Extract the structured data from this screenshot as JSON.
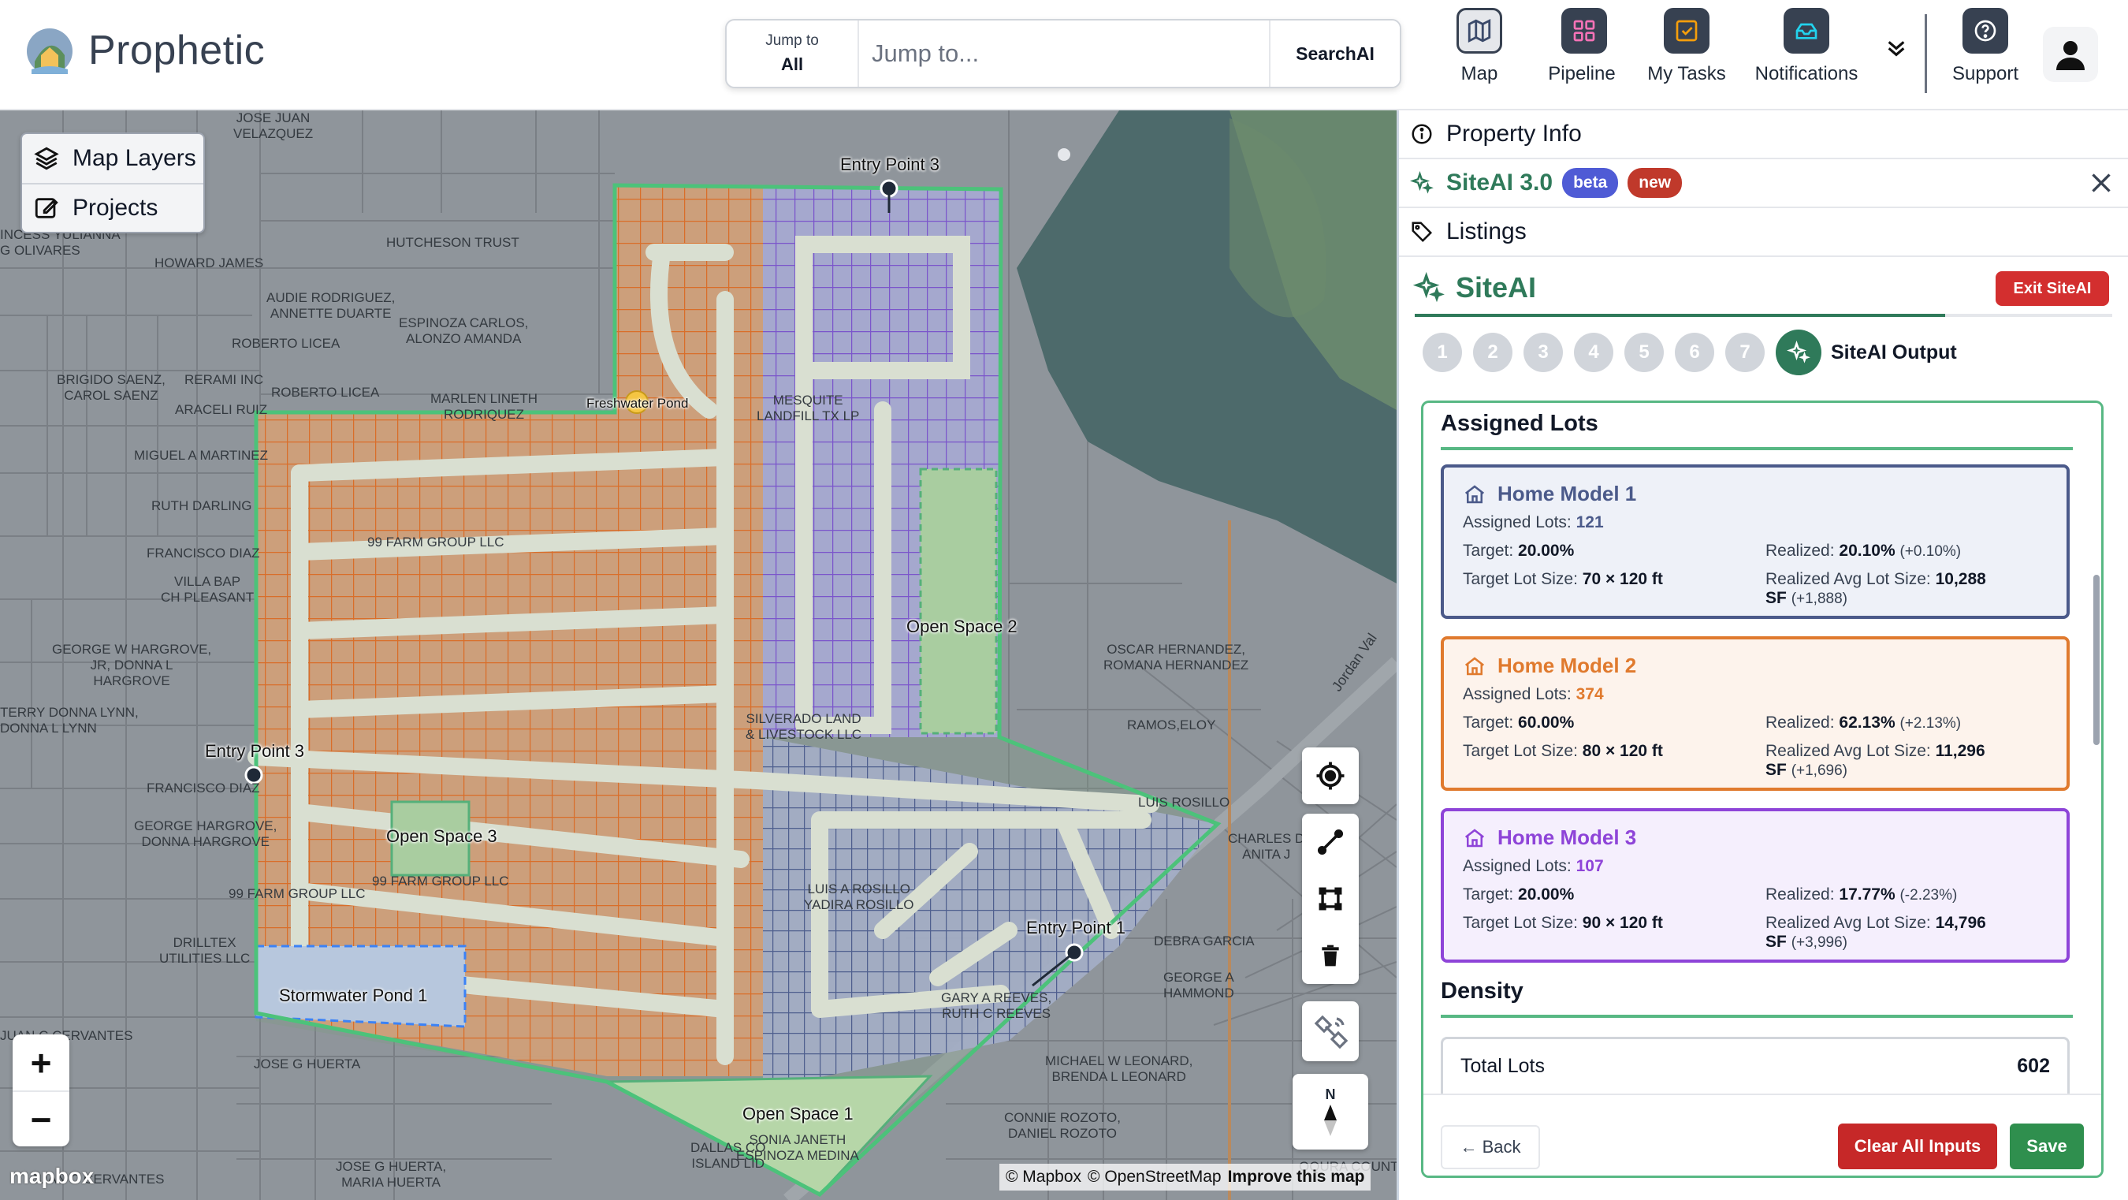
{
  "header": {
    "brand": "Prophetic",
    "search": {
      "scope_caption": "Jump to",
      "scope_value": "All",
      "placeholder": "Jump to...",
      "button": "SearchAI"
    },
    "nav": [
      {
        "label": "Map",
        "icon": "map-icon",
        "active": true
      },
      {
        "label": "Pipeline",
        "icon": "pipeline-icon"
      },
      {
        "label": "My Tasks",
        "icon": "tasks-icon"
      },
      {
        "label": "Notifications",
        "icon": "notifications-icon"
      },
      {
        "label": "Support",
        "icon": "support-icon"
      }
    ]
  },
  "map": {
    "layers_panel": {
      "map_layers": "Map Layers",
      "projects": "Projects"
    },
    "place_labels": {
      "entry1": "Entry Point 1",
      "entry3_top": "Entry Point 3",
      "entry3_left": "Entry Point 3",
      "open1": "Open Space 1",
      "open2": "Open Space 2",
      "open3": "Open Space 3",
      "storm": "Stormwater Pond 1",
      "fresh": "Freshwater Pond"
    },
    "owner_labels": [
      "JOSE JUAN\nVELAZQUEZ",
      "INCESS YULIANNA\nG OLIVARES",
      "HOWARD JAMES",
      "HUTCHESON TRUST",
      "AUDIE RODRIGUEZ,\nANNETTE DUARTE",
      "ESPINOZA CARLOS,\nALONZO AMANDA",
      "ROBERTO LICEA",
      "BRIGIDO SAENZ,\nCAROL SAENZ",
      "RERAMI INC",
      "ROBERTO LICEA",
      "ARACELI RUIZ",
      "MARLEN LINETH\nRODRIQUEZ",
      "MESQUITE\nLANDFILL TX LP",
      "MIGUEL A MARTINEZ",
      "RUTH DARLING",
      "99 FARM GROUP LLC",
      "FRANCISCO DIAZ",
      "VILLA BAP\nCH PLEASANT",
      "GEORGE W HARGROVE,\nJR, DONNA L\nHARGROVE",
      "TERRY DONNA LYNN,\nDONNA L LYNN",
      "SILVERADO LAND\n& LIVESTOCK LLC",
      "OSCAR HERNANDEZ,\nROMANA HERNANDEZ",
      "RAMOS,ELOY",
      "FRANCISCO DIAZ",
      "GEORGE HARGROVE,\nDONNA HARGROVE",
      "LUIS ROSILLO",
      "CHARLES D\nANITA J",
      "99 FARM GROUP LLC",
      "99 FARM GROUP LLC",
      "LUIS A ROSILLO\nYADIRA ROSILLO",
      "DRILLTEX\nUTILITIES LLC",
      "DEBRA GARCIA",
      "GEORGE A\nHAMMOND",
      "GARY A REEVES,\nRUTH C REEVES",
      "JOSE G HUERTA",
      "MICHAEL W LEONARD,\nBRENDA L LEONARD",
      "CONNIE ROZOTO,\nDANIEL ROZOTO",
      "SONIA JANETH\nESPINOZA MEDINA",
      "DALLAS CO\nISLAND LID",
      "JOSE G HUERTA,\nMARIA HUERTA",
      "JUAN C CERVANTES",
      "Jordan Val",
      "OQURA COUNT",
      "JUAN C CERVANTES"
    ],
    "compass_label": "N",
    "mapbox": "mapbox",
    "attribution": {
      "mapbox": "© Mapbox",
      "osm": "© OpenStreetMap",
      "improve": "Improve this map"
    },
    "zoom_in": "+",
    "zoom_out": "−"
  },
  "panel": {
    "property_info": "Property Info",
    "siteai_version": "SiteAI 3.0",
    "badge_beta": "beta",
    "badge_new": "new",
    "listings": "Listings",
    "siteai_title": "SiteAI",
    "exit_button": "Exit SiteAI",
    "steps": [
      "1",
      "2",
      "3",
      "4",
      "5",
      "6",
      "7"
    ],
    "step_output_label": "SiteAI Output",
    "progress": 0.76,
    "assigned_lots_title": "Assigned Lots",
    "labels": {
      "assigned_lots": "Assigned Lots:",
      "target": "Target:",
      "target_lot_size": "Target Lot Size:",
      "realized": "Realized:",
      "realized_avg_lot_size": "Realized Avg Lot Size:"
    },
    "models": [
      {
        "name": "Home Model 1",
        "assigned_lots": "121",
        "target": "20.00%",
        "target_lot_size": "70 × 120 ft",
        "realized": "20.10%",
        "realized_delta": "(+0.10%)",
        "realized_avg_lot_size": "10,288",
        "avg_unit": "SF",
        "avg_delta": "(+1,888)",
        "color": "#4b5a8a",
        "bg": "#eef1f8"
      },
      {
        "name": "Home Model 2",
        "assigned_lots": "374",
        "target": "60.00%",
        "target_lot_size": "80 × 120 ft",
        "realized": "62.13%",
        "realized_delta": "(+2.13%)",
        "realized_avg_lot_size": "11,296",
        "avg_unit": "SF",
        "avg_delta": "(+1,696)",
        "color": "#e07a2e",
        "bg": "#fdf3ec"
      },
      {
        "name": "Home Model 3",
        "assigned_lots": "107",
        "target": "20.00%",
        "target_lot_size": "90 × 120 ft",
        "realized": "17.77%",
        "realized_delta": "(-2.23%)",
        "realized_avg_lot_size": "14,796",
        "avg_unit": "SF",
        "avg_delta": "(+3,996)",
        "color": "#8e44d8",
        "bg": "#f5effd"
      }
    ],
    "density_title": "Density",
    "total_lots_label": "Total Lots",
    "total_lots_value": "602",
    "footer": {
      "back": "← Back",
      "clear": "Clear All Inputs",
      "save": "Save"
    }
  },
  "colors": {
    "accent_green": "#2f7a5a",
    "danger_red": "#d32f2f",
    "beta_blue": "#4f5bd5"
  }
}
